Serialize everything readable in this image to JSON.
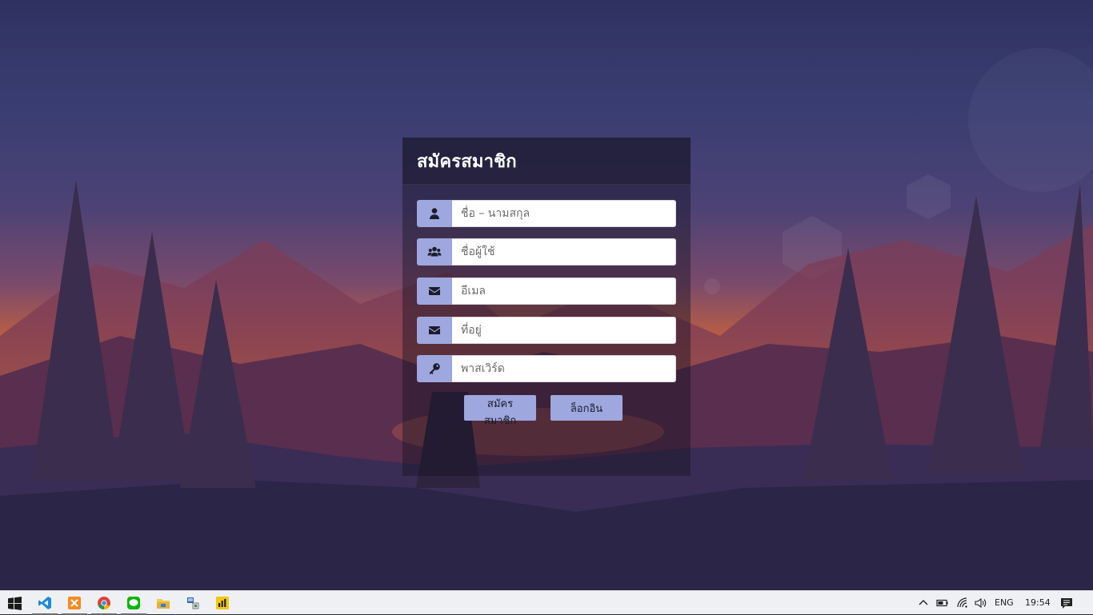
{
  "form": {
    "title": "สมัครสมาชิก",
    "fields": [
      {
        "placeholder": "ชื่อ – นามสกุล",
        "icon": "user-icon"
      },
      {
        "placeholder": "ชื่อผู้ใช้",
        "icon": "users-icon"
      },
      {
        "placeholder": "อีเมล",
        "icon": "envelope-icon"
      },
      {
        "placeholder": "ที่อยู่",
        "icon": "envelope-icon"
      },
      {
        "placeholder": "พาสเวิร์ด",
        "icon": "key-icon"
      }
    ],
    "register_label": "สมัครสมาชิก",
    "login_label": "ล็อกอิน",
    "colors": {
      "addon": "#9ea7de",
      "button": "#9ea7de",
      "panel": "#1e1b33"
    }
  },
  "taskbar": {
    "apps": [
      "start-icon",
      "vscode-icon",
      "xampp-icon",
      "chrome-icon",
      "line-icon",
      "file-explorer-icon",
      "network-tool-icon",
      "powerbi-icon"
    ],
    "language": "ENG",
    "time": "19:54"
  }
}
